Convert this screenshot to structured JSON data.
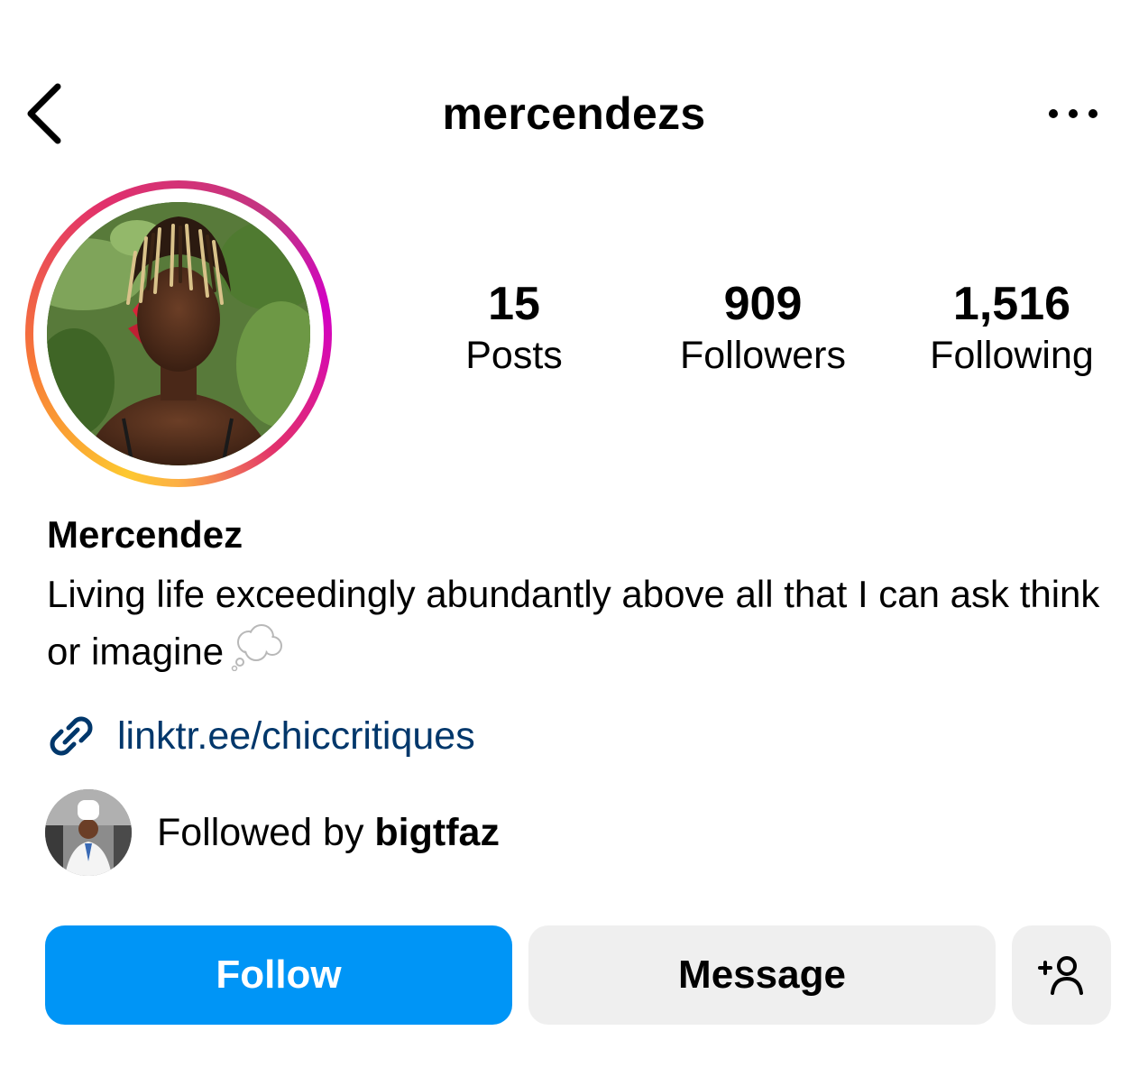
{
  "header": {
    "username": "mercendezs",
    "back_icon": "chevron-left-icon",
    "more_icon": "more-horizontal-icon"
  },
  "profile": {
    "avatar_ring_colors": [
      "#fdc830",
      "#f77737",
      "#e1306c",
      "#c13584",
      "#d300c5"
    ],
    "display_name": "Mercendez",
    "bio": "Living life exceedingly abundantly above all that I can ask think or imagine",
    "bio_emoji": "thought-balloon-icon",
    "link": "linktr.ee/chiccritiques",
    "link_color": "#00376b",
    "followed_by_prefix": "Followed by ",
    "followed_by_user": "bigtfaz"
  },
  "stats": [
    {
      "value": "15",
      "label": "Posts"
    },
    {
      "value": "909",
      "label": "Followers"
    },
    {
      "value": "1,516",
      "label": "Following"
    }
  ],
  "actions": {
    "follow_label": "Follow",
    "follow_color": "#0095f6",
    "message_label": "Message",
    "add_user_icon": "add-user-icon"
  }
}
